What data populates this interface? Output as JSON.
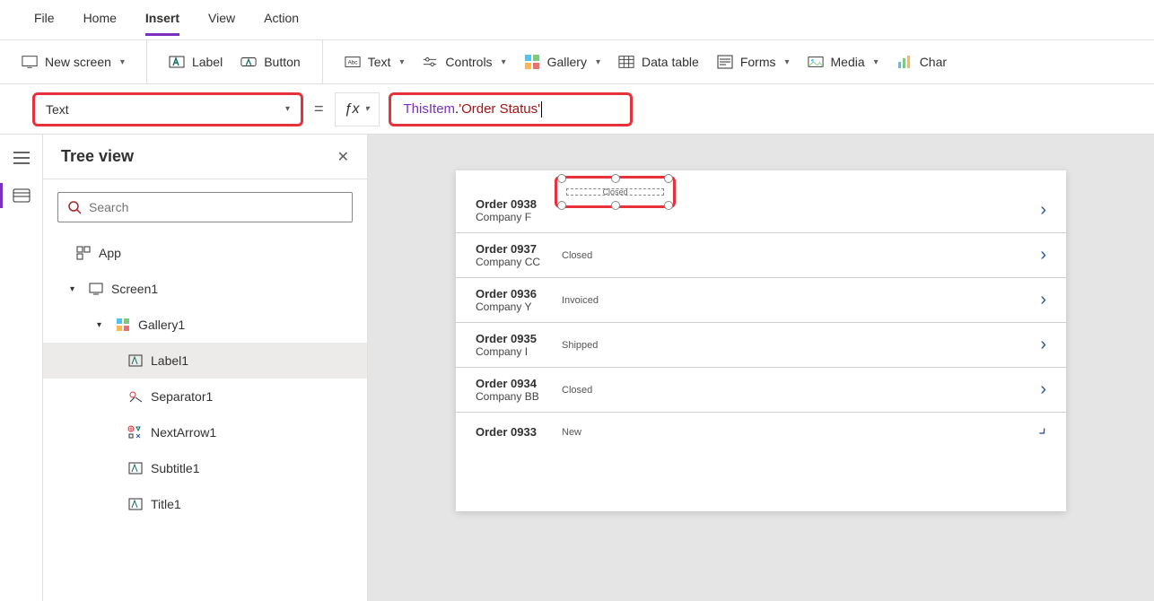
{
  "menu": {
    "items": [
      "File",
      "Home",
      "Insert",
      "View",
      "Action"
    ],
    "active": "Insert"
  },
  "ribbon": {
    "new_screen": "New screen",
    "label": "Label",
    "button": "Button",
    "text": "Text",
    "controls": "Controls",
    "gallery": "Gallery",
    "data_table": "Data table",
    "forms": "Forms",
    "media": "Media",
    "char": "Char"
  },
  "formula": {
    "property": "Text",
    "eq": "=",
    "fx": "fx",
    "this": "ThisItem",
    "dot": ".",
    "str": "'Order Status'"
  },
  "tree": {
    "title": "Tree view",
    "search_placeholder": "Search",
    "nodes": {
      "app": "App",
      "screen1": "Screen1",
      "gallery1": "Gallery1",
      "label1": "Label1",
      "separator1": "Separator1",
      "nextarrow1": "NextArrow1",
      "subtitle1": "Subtitle1",
      "title1": "Title1"
    }
  },
  "canvas": {
    "items": [
      {
        "title": "Order 0938",
        "subtitle": "Company F",
        "status": "Closed"
      },
      {
        "title": "Order 0937",
        "subtitle": "Company CC",
        "status": "Closed"
      },
      {
        "title": "Order 0936",
        "subtitle": "Company Y",
        "status": "Invoiced"
      },
      {
        "title": "Order 0935",
        "subtitle": "Company I",
        "status": "Shipped"
      },
      {
        "title": "Order 0934",
        "subtitle": "Company BB",
        "status": "Closed"
      },
      {
        "title": "Order 0933",
        "subtitle": "",
        "status": "New"
      }
    ]
  }
}
